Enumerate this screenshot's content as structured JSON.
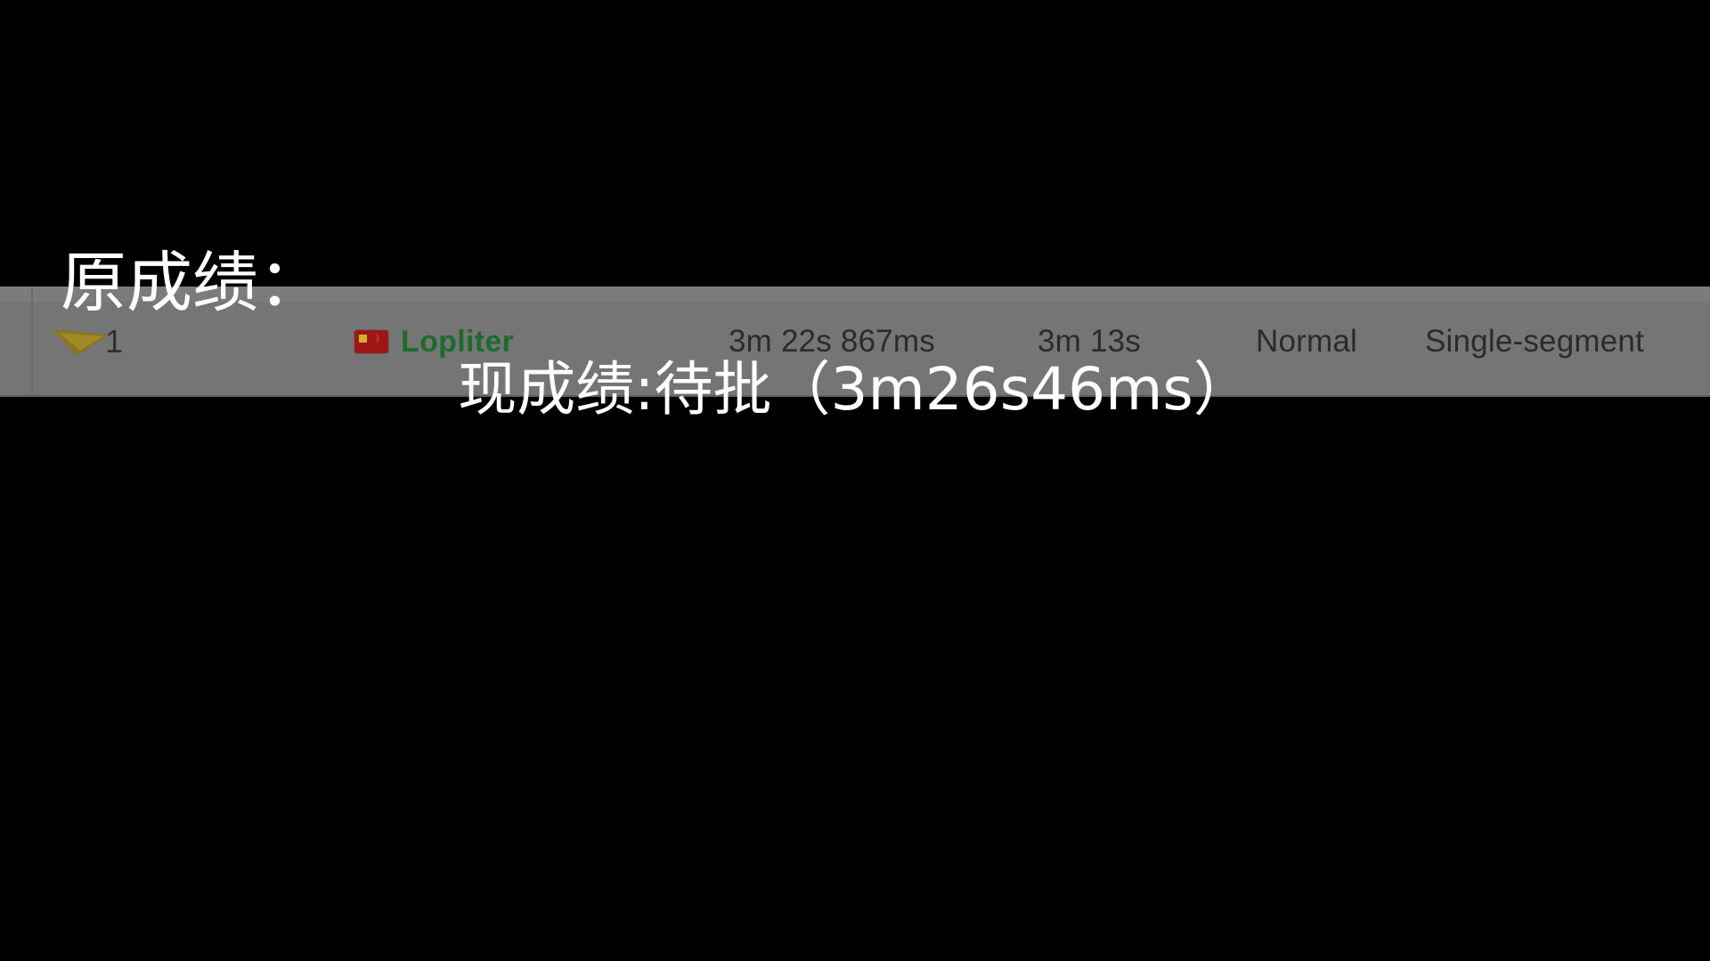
{
  "background_color": "#000000",
  "overlay": {
    "original_label": "原成绩：",
    "current_result": "现成绩:待批（3m26s46ms）",
    "text_color": "#ffffff"
  },
  "leaderboard_row": {
    "strip_color": "#757575",
    "rank": "1",
    "place_ornament_icon": "laurel-wreath-icon",
    "flag_icon": "china-flag-icon",
    "player_name": "Lopliter",
    "player_name_color": "#1d6b2e",
    "real_time": "3m 22s 867ms",
    "in_game_time": "3m 13s",
    "run_category": "Normal",
    "run_type": "Single-segment"
  }
}
